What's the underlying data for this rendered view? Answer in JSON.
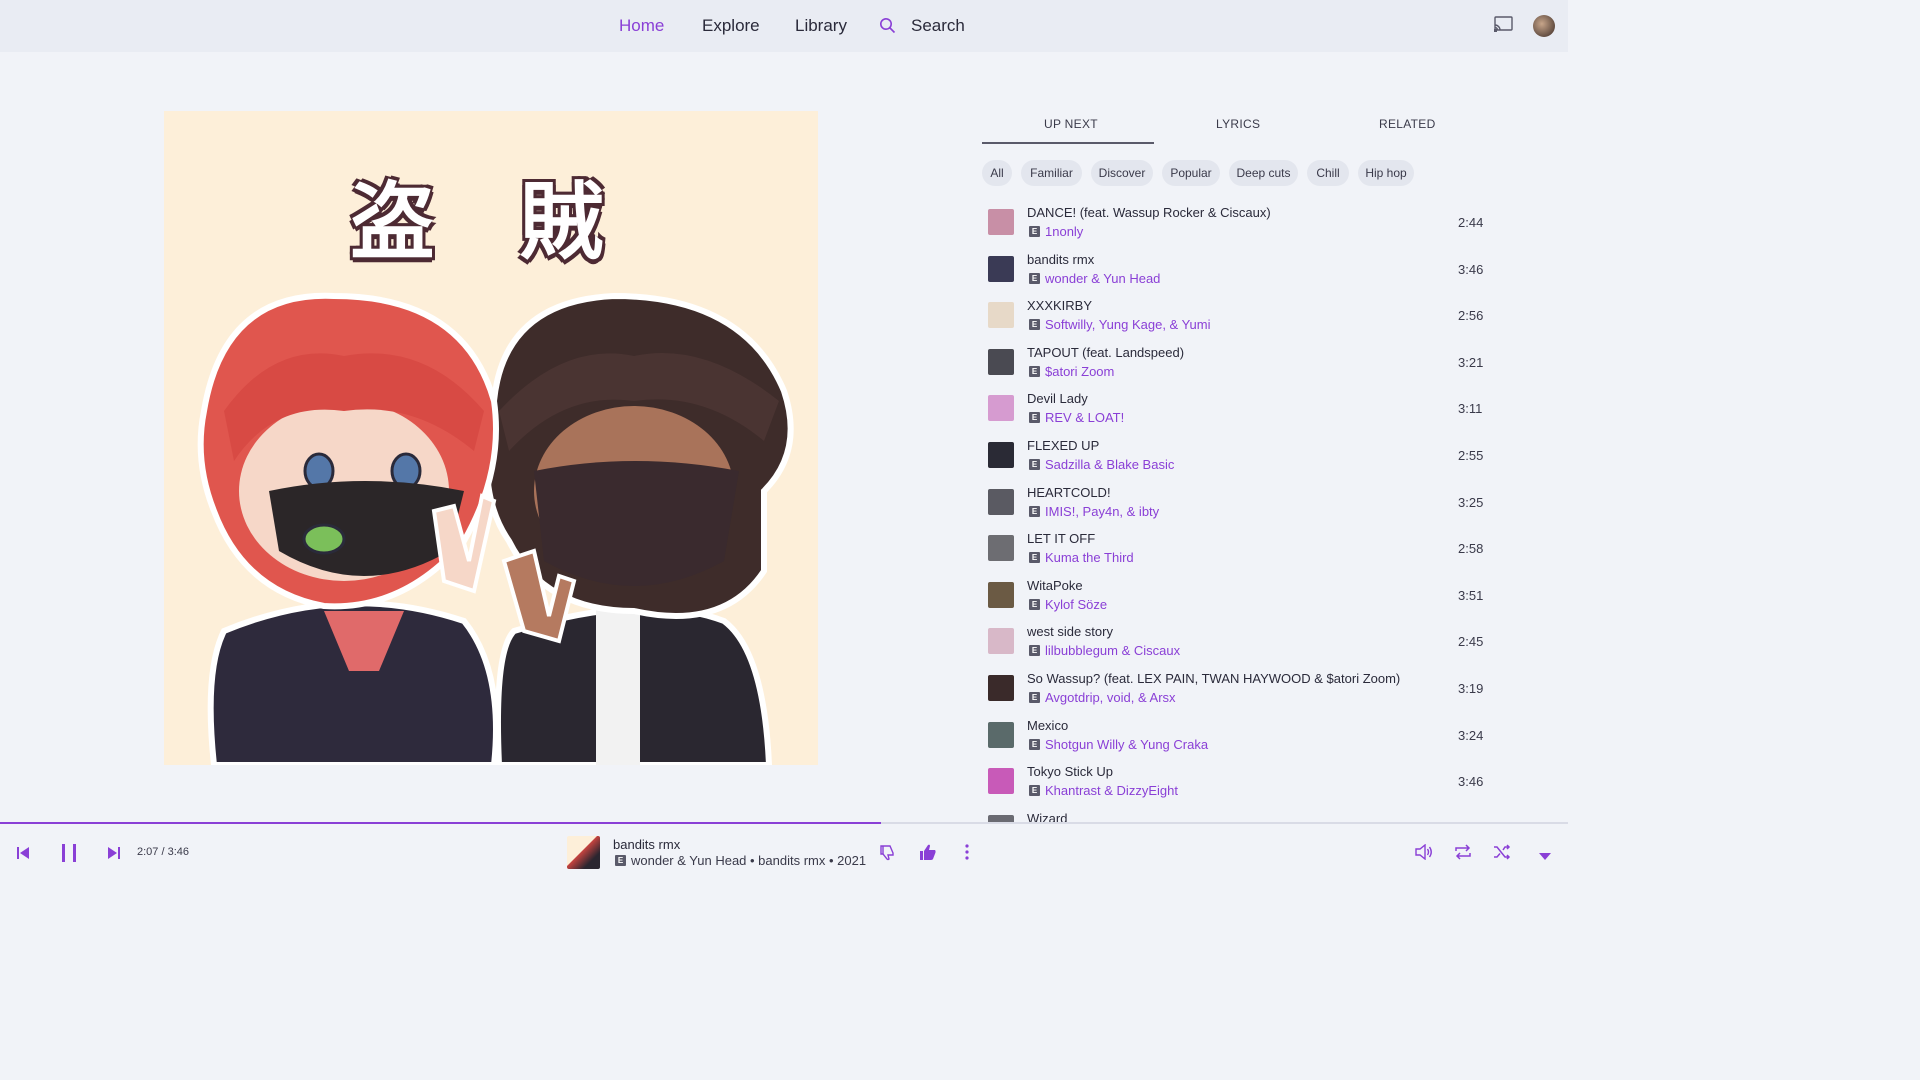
{
  "nav": {
    "home": "Home",
    "explore": "Explore",
    "library": "Library",
    "search": "Search"
  },
  "art": {
    "title": "盗 賊"
  },
  "tabs": {
    "up_next": "UP NEXT",
    "lyrics": "LYRICS",
    "related": "RELATED"
  },
  "chips": [
    "All",
    "Familiar",
    "Discover",
    "Popular",
    "Deep cuts",
    "Chill",
    "Hip hop"
  ],
  "explicit_label": "E",
  "queue": [
    {
      "title": "DANCE! (feat. Wassup Rocker & Ciscaux)",
      "artist": "1nonly",
      "duration": "2:44",
      "thumb_color": "#c88fa6"
    },
    {
      "title": "bandits rmx",
      "artist": "wonder & Yun Head",
      "duration": "3:46",
      "thumb_color": "#3a3a55"
    },
    {
      "title": "XXXKIRBY",
      "artist": "Softwilly, Yung Kage, & Yumi",
      "duration": "2:56",
      "thumb_color": "#e7d9c8"
    },
    {
      "title": "TAPOUT (feat. Landspeed)",
      "artist": "$atori Zoom",
      "duration": "3:21",
      "thumb_color": "#4a4a52"
    },
    {
      "title": "Devil Lady",
      "artist": "REV & LOAT!",
      "duration": "3:11",
      "thumb_color": "#d69bd0"
    },
    {
      "title": "FLEXED UP",
      "artist": "Sadzilla & Blake Basic",
      "duration": "2:55",
      "thumb_color": "#2a2a35"
    },
    {
      "title": "HEARTCOLD!",
      "artist": "IMIS!, Pay4n, & ibty",
      "duration": "3:25",
      "thumb_color": "#5a5a62"
    },
    {
      "title": "LET IT OFF",
      "artist": "Kuma the Third",
      "duration": "2:58",
      "thumb_color": "#6d6d72"
    },
    {
      "title": "WitaPoke",
      "artist": "Kylof Söze",
      "duration": "3:51",
      "thumb_color": "#6b5a44"
    },
    {
      "title": "west side story",
      "artist": "lilbubblegum & Ciscaux",
      "duration": "2:45",
      "thumb_color": "#d8b8c8"
    },
    {
      "title": "So Wassup? (feat. LEX PAIN, TWAN HAYWOOD & $atori Zoom)",
      "artist": "Avgotdrip, void, & Arsx",
      "duration": "3:19",
      "thumb_color": "#3a2a2a"
    },
    {
      "title": "Mexico",
      "artist": "Shotgun Willy & Yung Craka",
      "duration": "3:24",
      "thumb_color": "#5a6a6a"
    },
    {
      "title": "Tokyo Stick Up",
      "artist": "Khantrast & DizzyEight",
      "duration": "3:46",
      "thumb_color": "#c85ab8"
    },
    {
      "title": "Wizard",
      "artist": "",
      "duration": "",
      "thumb_color": "#6a6a72"
    }
  ],
  "player": {
    "time": "2:07 / 3:46",
    "progress_fraction": 0.562,
    "title": "bandits rmx",
    "subtitle": "wonder & Yun Head • bandits rmx • 2021"
  },
  "colors": {
    "accent": "#8a3fd6",
    "background": "#f1f3f8"
  }
}
